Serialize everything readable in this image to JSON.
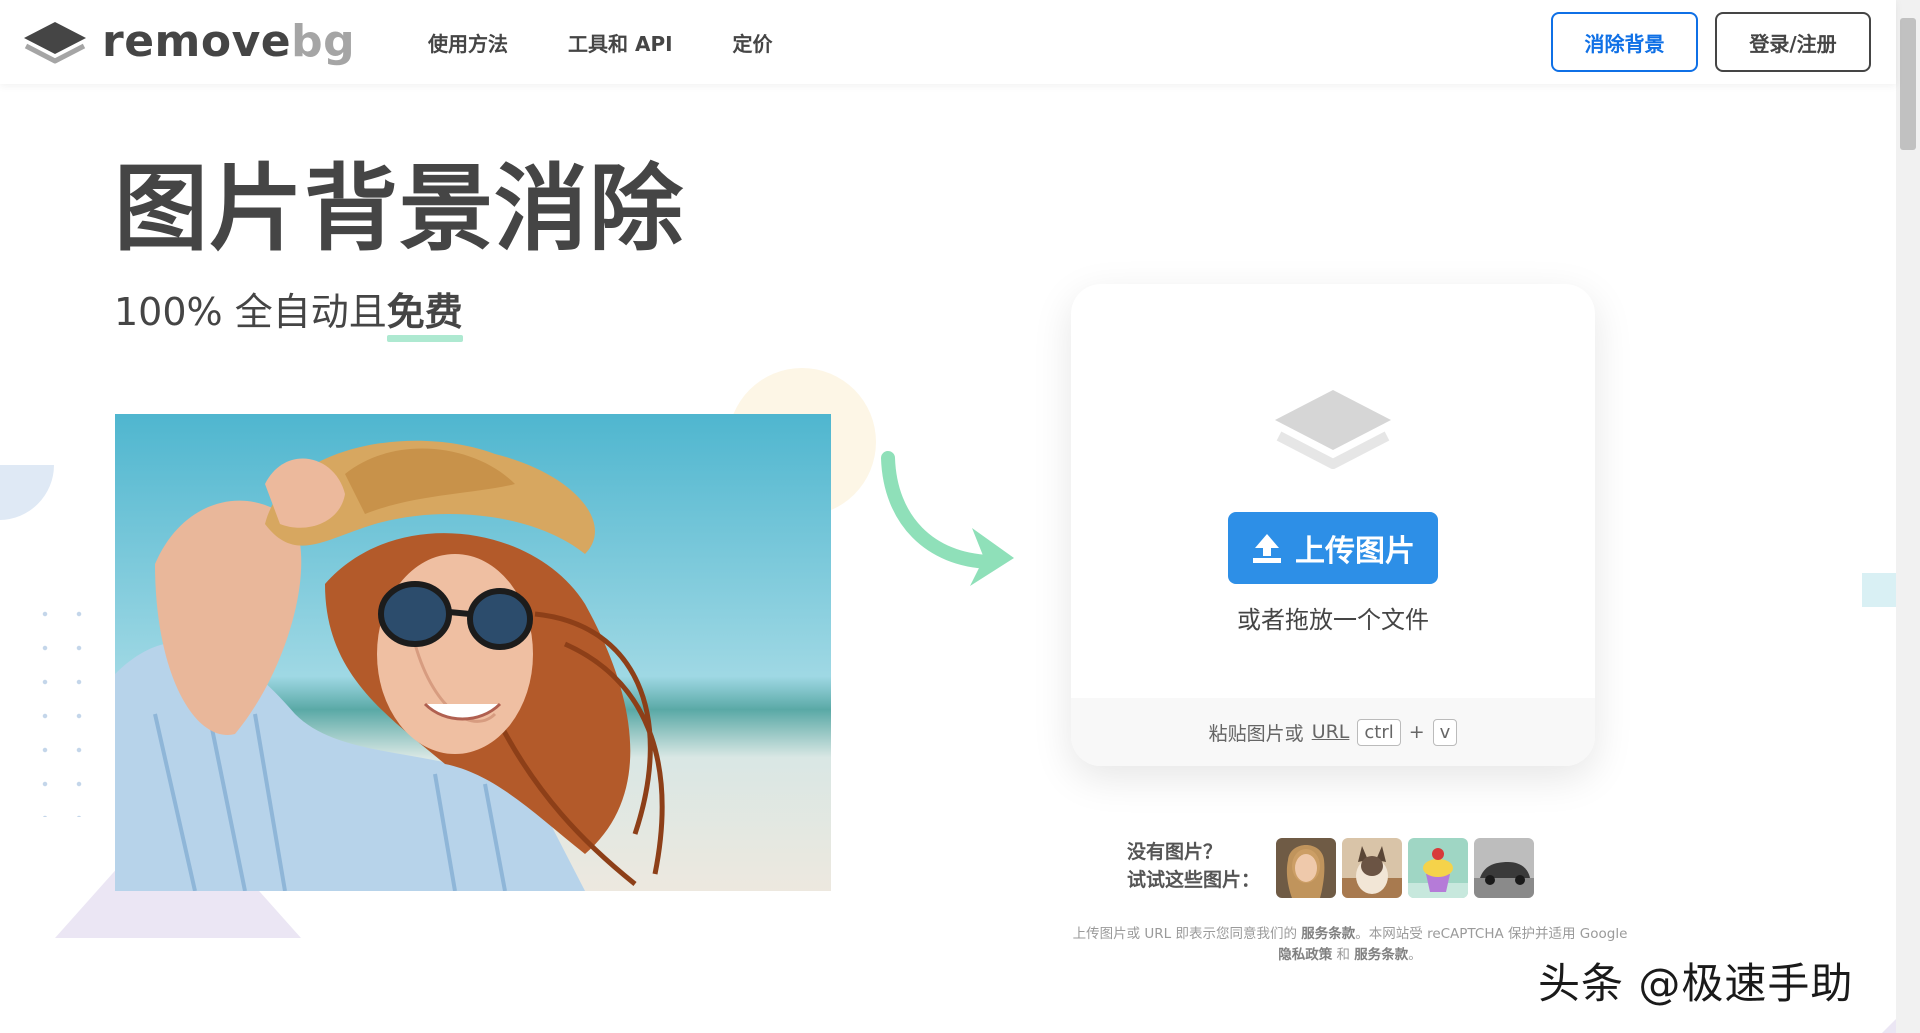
{
  "header": {
    "logo_text_primary": "remove",
    "logo_text_secondary": "bg",
    "nav": [
      "使用方法",
      "工具和 API",
      "定价"
    ],
    "remove_bg_button": "消除背景",
    "login_button": "登录/注册"
  },
  "hero": {
    "title": "图片背景消除",
    "subtitle_prefix": "100% 全自动且",
    "subtitle_emphasis": "免费"
  },
  "upload": {
    "button_label": "上传图片",
    "drop_text": "或者拖放一个文件",
    "paste_prefix": "粘贴图片或",
    "paste_url": "URL",
    "key_ctrl": "ctrl",
    "key_plus": "+",
    "key_v": "v"
  },
  "samples": {
    "line1": "没有图片？",
    "line2": "试试这些图片：",
    "items": [
      "woman",
      "cat",
      "cupcake",
      "car"
    ]
  },
  "legal": {
    "line1_a": "上传图片或 URL 即表示您同意我们的",
    "line1_terms": "服务条款",
    "line1_b": "。本网站受 reCAPTCHA 保护并适用 Google",
    "line2_privacy": "隐私政策",
    "line2_and": "和",
    "line2_terms": "服务条款",
    "line2_end": "。"
  },
  "watermark": "头条 @极速手助",
  "colors": {
    "accent_blue": "#2d8fe7",
    "outline_blue": "#0f70e6",
    "highlight_green": "#aee9d1",
    "arrow_green": "#8fe0b9"
  }
}
